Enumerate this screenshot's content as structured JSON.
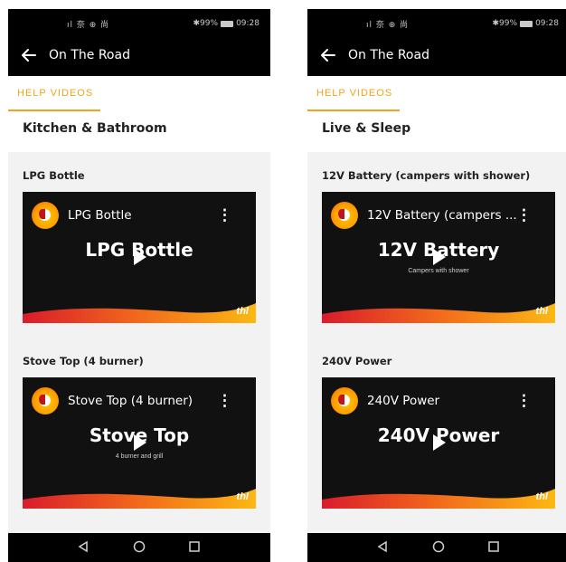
{
  "screens": [
    {
      "status": {
        "signal": "ıl 奈 ⊕ 尚",
        "battery": "✱99%",
        "time": "09:28"
      },
      "appbar": {
        "title": "On The Road"
      },
      "tab": {
        "label": "HELP VIDEOS"
      },
      "category": {
        "name": "Kitchen & Bathroom"
      },
      "videos": [
        {
          "title": "LPG Bottle",
          "player_title": "LPG Bottle",
          "overlay_text": "LPG Bottle",
          "overlay_sub": "",
          "brand": "thl"
        },
        {
          "title": "Stove Top (4 burner)",
          "player_title": "Stove Top (4 burner)",
          "overlay_text": "Stove Top",
          "overlay_sub": "4 burner and grill",
          "brand": "thl"
        }
      ]
    },
    {
      "status": {
        "signal": "ıl 奈 ⊕ 尚",
        "battery": "✱99%",
        "time": "09:28"
      },
      "appbar": {
        "title": "On The Road"
      },
      "tab": {
        "label": "HELP VIDEOS"
      },
      "category": {
        "name": "Live & Sleep"
      },
      "videos": [
        {
          "title": "12V Battery (campers with shower)",
          "player_title": "12V Battery (campers ...",
          "overlay_text": "12V Battery",
          "overlay_sub": "Campers with shower",
          "brand": "thl"
        },
        {
          "title": "240V Power",
          "player_title": "240V Power",
          "overlay_text": "240V Power",
          "overlay_sub": "",
          "brand": "thl"
        }
      ]
    }
  ],
  "colors": {
    "accent": "#f2a31b",
    "appbar": "#000000",
    "panel": "#f2f2f2"
  },
  "icons": {
    "back": "arrow-left-icon",
    "menu": "more-vertical-icon",
    "play": "play-icon",
    "nav_back": "triangle-back-icon",
    "nav_home": "circle-home-icon",
    "nav_recent": "square-recent-icon"
  }
}
